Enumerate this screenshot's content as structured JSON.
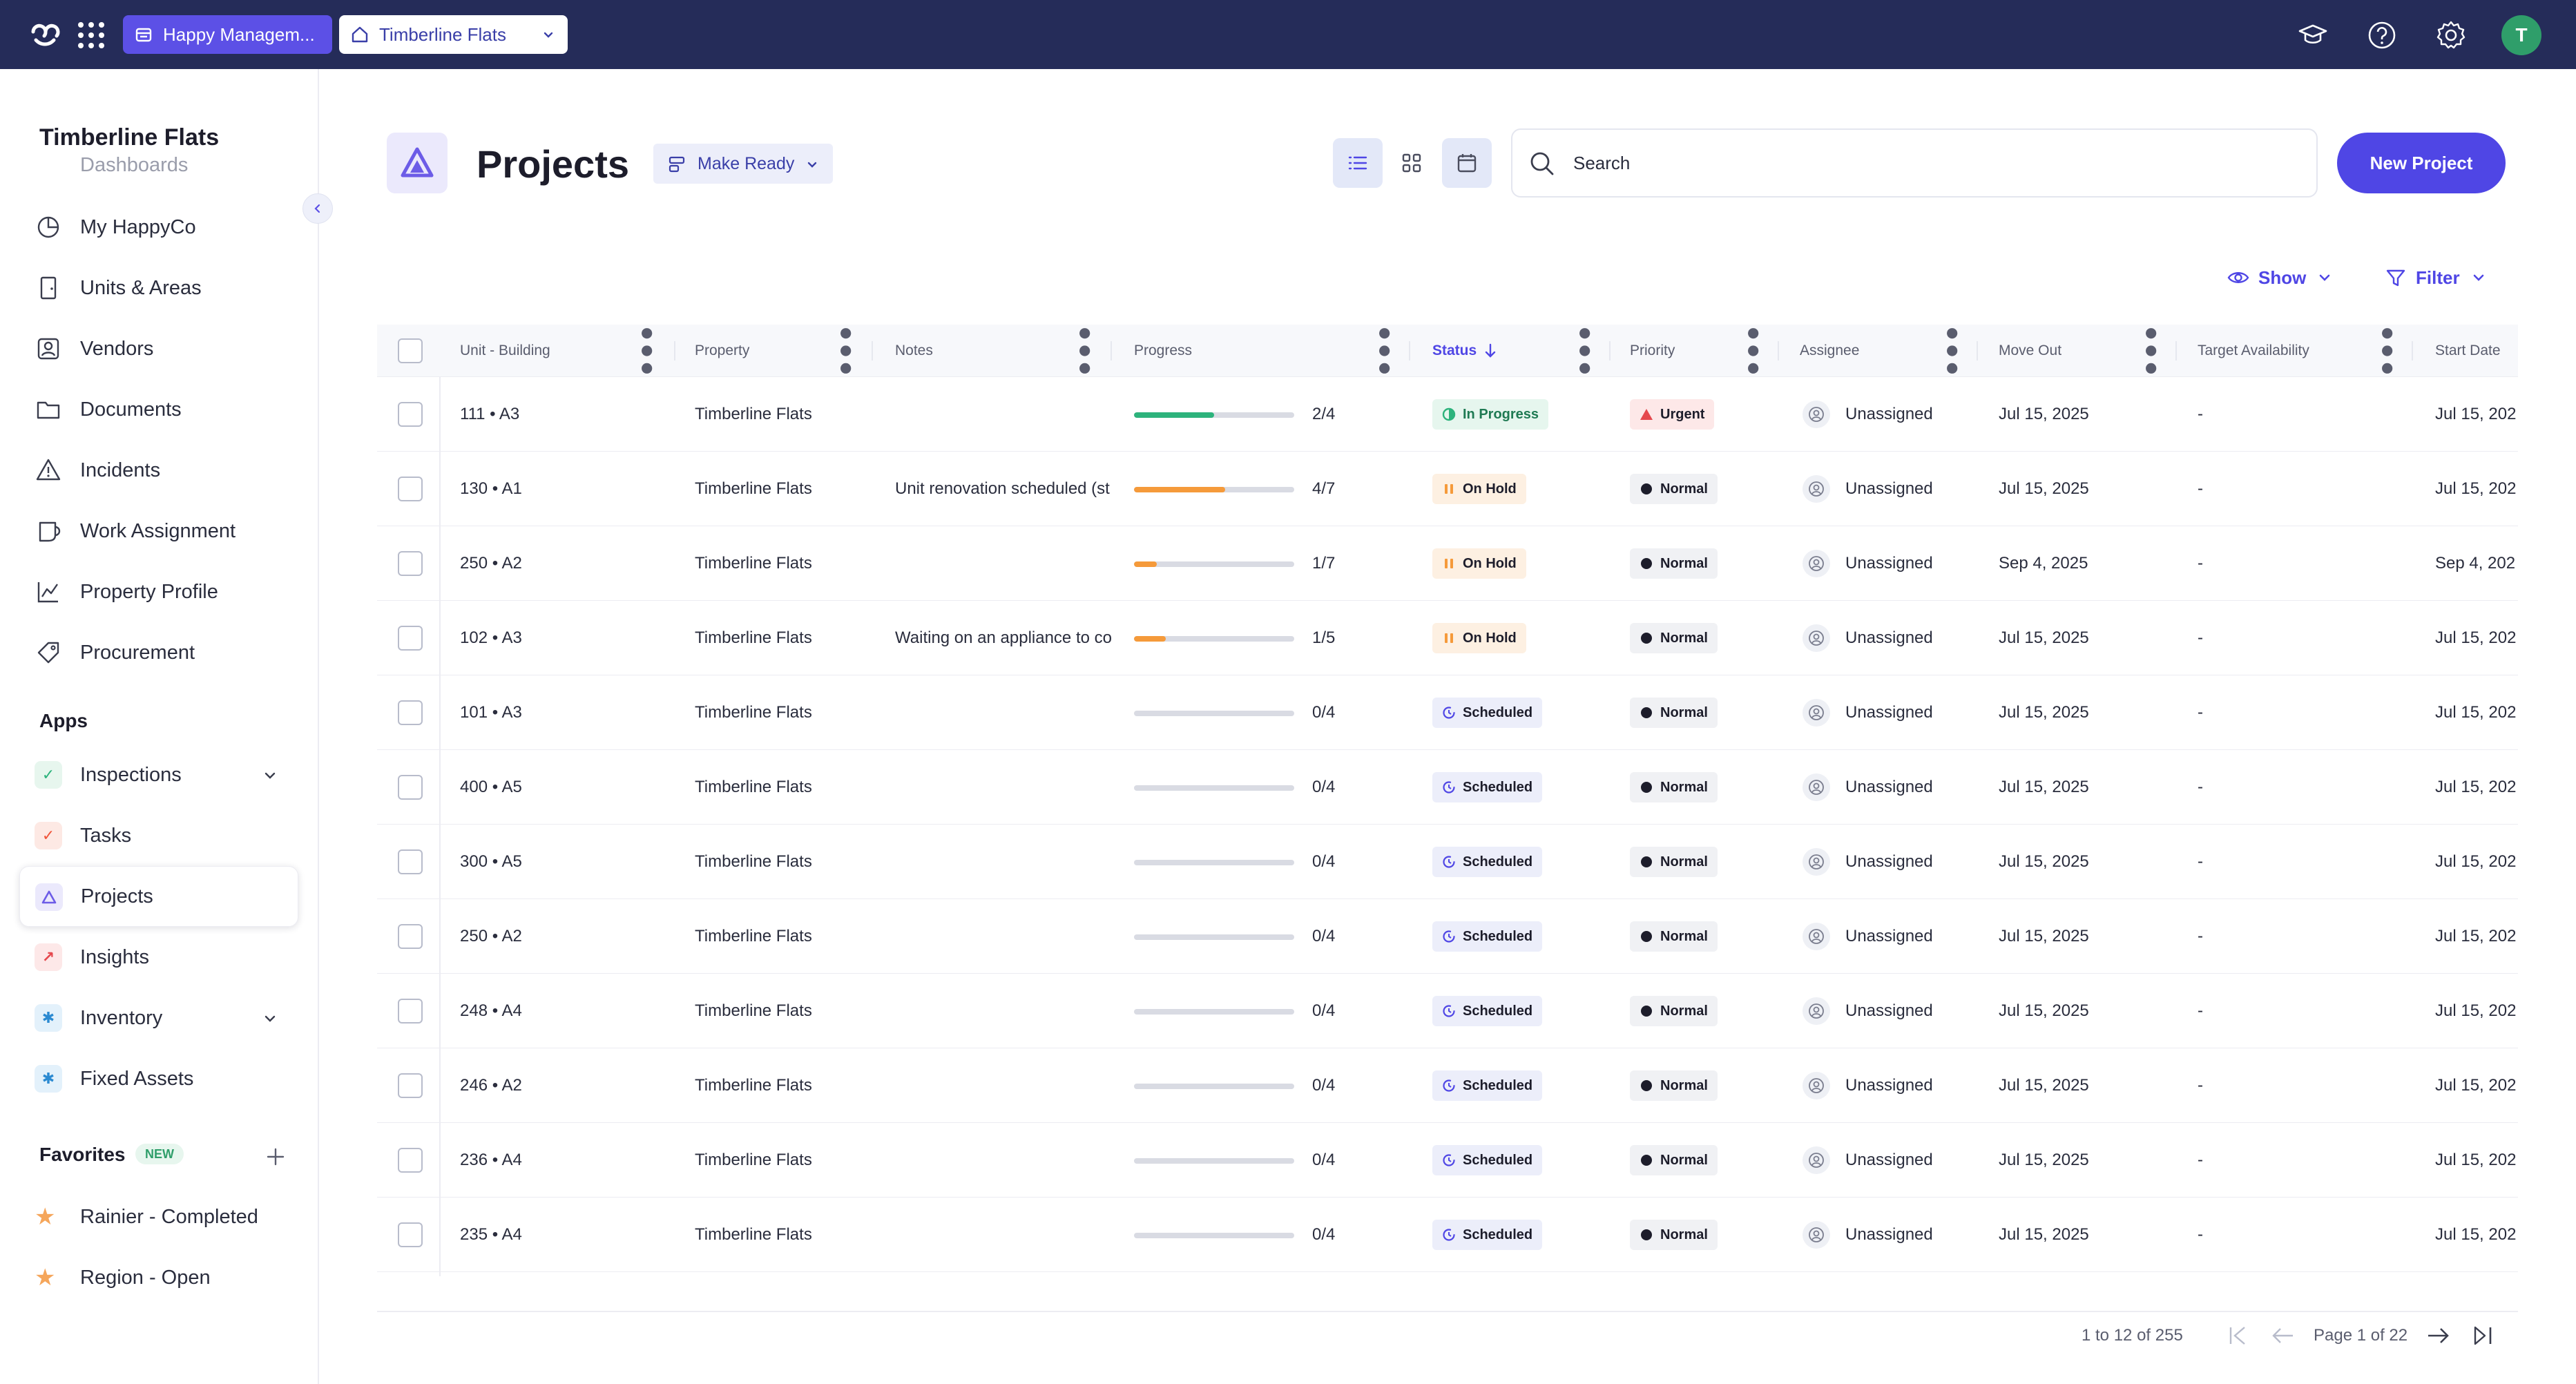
{
  "topbar": {
    "org_label": "Happy Managem...",
    "property_label": "Timberline Flats",
    "avatar_initial": "T"
  },
  "sidebar": {
    "title": "Timberline Flats",
    "nav": [
      {
        "label": "Dashboards",
        "icon": "dashboard-icon"
      },
      {
        "label": "My HappyCo",
        "icon": "pie-chart-icon"
      },
      {
        "label": "Units & Areas",
        "icon": "door-icon"
      },
      {
        "label": "Vendors",
        "icon": "vendor-icon"
      },
      {
        "label": "Documents",
        "icon": "folder-icon"
      },
      {
        "label": "Incidents",
        "icon": "warning-icon"
      },
      {
        "label": "Work Assignment",
        "icon": "work-assignment-icon"
      },
      {
        "label": "Property Profile",
        "icon": "line-chart-icon"
      },
      {
        "label": "Procurement",
        "icon": "tag-icon"
      }
    ],
    "apps_heading": "Apps",
    "apps": [
      {
        "label": "Inspections",
        "icon": "inspections-icon",
        "expandable": true
      },
      {
        "label": "Tasks",
        "icon": "tasks-icon",
        "expandable": false
      },
      {
        "label": "Projects",
        "icon": "projects-icon",
        "expandable": false,
        "active": true
      },
      {
        "label": "Insights",
        "icon": "insights-icon",
        "expandable": false
      },
      {
        "label": "Inventory",
        "icon": "inventory-icon",
        "expandable": true
      },
      {
        "label": "Fixed Assets",
        "icon": "fixed-assets-icon",
        "expandable": false
      }
    ],
    "favorites_heading": "Favorites",
    "favorites_badge": "NEW",
    "favorites": [
      {
        "label": "Rainier - Completed",
        "icon": "star-icon"
      },
      {
        "label": "Region - Open",
        "icon": "star-icon"
      }
    ]
  },
  "header": {
    "title": "Projects",
    "template_select": "Make Ready",
    "search_placeholder": "Search",
    "new_project_label": "New Project",
    "show_label": "Show",
    "filter_label": "Filter"
  },
  "table": {
    "columns": [
      "Unit - Building",
      "Property",
      "Notes",
      "Progress",
      "Status",
      "Priority",
      "Assignee",
      "Move Out",
      "Target Availability",
      "Start Date"
    ],
    "sorted_column": "Status",
    "rows": [
      {
        "unit": "111 • A3",
        "property": "Timberline Flats",
        "notes": "",
        "progress": "2/4",
        "progress_fraction": 0.5,
        "status": "In Progress",
        "priority": "Urgent",
        "assignee": "Unassigned",
        "move_out": "Jul 15, 2025",
        "target": "-",
        "start": "Jul 15, 202"
      },
      {
        "unit": "130 • A1",
        "property": "Timberline Flats",
        "notes": "Unit renovation scheduled (st",
        "progress": "4/7",
        "progress_fraction": 0.571,
        "status": "On Hold",
        "priority": "Normal",
        "assignee": "Unassigned",
        "move_out": "Jul 15, 2025",
        "target": "-",
        "start": "Jul 15, 202"
      },
      {
        "unit": "250 • A2",
        "property": "Timberline Flats",
        "notes": "",
        "progress": "1/7",
        "progress_fraction": 0.143,
        "status": "On Hold",
        "priority": "Normal",
        "assignee": "Unassigned",
        "move_out": "Sep 4, 2025",
        "target": "-",
        "start": "Sep 4, 202"
      },
      {
        "unit": "102 • A3",
        "property": "Timberline Flats",
        "notes": "Waiting on an appliance to co",
        "progress": "1/5",
        "progress_fraction": 0.2,
        "status": "On Hold",
        "priority": "Normal",
        "assignee": "Unassigned",
        "move_out": "Jul 15, 2025",
        "target": "-",
        "start": "Jul 15, 202"
      },
      {
        "unit": "101 • A3",
        "property": "Timberline Flats",
        "notes": "",
        "progress": "0/4",
        "progress_fraction": 0,
        "status": "Scheduled",
        "priority": "Normal",
        "assignee": "Unassigned",
        "move_out": "Jul 15, 2025",
        "target": "-",
        "start": "Jul 15, 202"
      },
      {
        "unit": "400 • A5",
        "property": "Timberline Flats",
        "notes": "",
        "progress": "0/4",
        "progress_fraction": 0,
        "status": "Scheduled",
        "priority": "Normal",
        "assignee": "Unassigned",
        "move_out": "Jul 15, 2025",
        "target": "-",
        "start": "Jul 15, 202"
      },
      {
        "unit": "300 • A5",
        "property": "Timberline Flats",
        "notes": "",
        "progress": "0/4",
        "progress_fraction": 0,
        "status": "Scheduled",
        "priority": "Normal",
        "assignee": "Unassigned",
        "move_out": "Jul 15, 2025",
        "target": "-",
        "start": "Jul 15, 202"
      },
      {
        "unit": "250 • A2",
        "property": "Timberline Flats",
        "notes": "",
        "progress": "0/4",
        "progress_fraction": 0,
        "status": "Scheduled",
        "priority": "Normal",
        "assignee": "Unassigned",
        "move_out": "Jul 15, 2025",
        "target": "-",
        "start": "Jul 15, 202"
      },
      {
        "unit": "248 • A4",
        "property": "Timberline Flats",
        "notes": "",
        "progress": "0/4",
        "progress_fraction": 0,
        "status": "Scheduled",
        "priority": "Normal",
        "assignee": "Unassigned",
        "move_out": "Jul 15, 2025",
        "target": "-",
        "start": "Jul 15, 202"
      },
      {
        "unit": "246 • A2",
        "property": "Timberline Flats",
        "notes": "",
        "progress": "0/4",
        "progress_fraction": 0,
        "status": "Scheduled",
        "priority": "Normal",
        "assignee": "Unassigned",
        "move_out": "Jul 15, 2025",
        "target": "-",
        "start": "Jul 15, 202"
      },
      {
        "unit": "236 • A4",
        "property": "Timberline Flats",
        "notes": "",
        "progress": "0/4",
        "progress_fraction": 0,
        "status": "Scheduled",
        "priority": "Normal",
        "assignee": "Unassigned",
        "move_out": "Jul 15, 2025",
        "target": "-",
        "start": "Jul 15, 202"
      },
      {
        "unit": "235 • A4",
        "property": "Timberline Flats",
        "notes": "",
        "progress": "0/4",
        "progress_fraction": 0,
        "status": "Scheduled",
        "priority": "Normal",
        "assignee": "Unassigned",
        "move_out": "Jul 15, 2025",
        "target": "-",
        "start": "Jul 15, 202"
      }
    ]
  },
  "pagination": {
    "range_label": "1 to 12 of 255",
    "page_label": "Page 1 of 22"
  },
  "colors": {
    "topbar": "#252c59",
    "accent": "#4f46e5",
    "progress_green": "#2db37c",
    "progress_orange": "#f59a3a",
    "in_progress_bg": "#e6f6ee",
    "on_hold_bg": "#fdf0e2",
    "scheduled_bg": "#eceefa",
    "urgent_bg": "#fde8e8",
    "normal_bg": "#f0f1f4"
  }
}
